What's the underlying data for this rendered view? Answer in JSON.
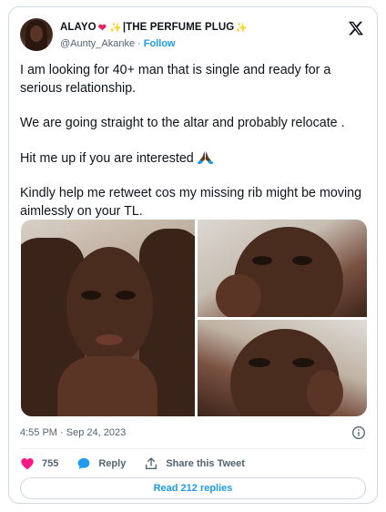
{
  "author": {
    "name": "ALAYO",
    "name_suffix": "|THE PERFUME PLUG",
    "handle": "@Aunty_Akanke",
    "separator": "·",
    "follow_label": "Follow"
  },
  "tweet": {
    "paragraphs": [
      "I am looking for 40+ man that is single and ready for a serious relationship.",
      "We are going straight to the altar and probably relocate .",
      "Hit me up if you are interested",
      "Kindly help me retweet cos my missing rib might be moving aimlessly on your TL."
    ],
    "timestamp": "4:55 PM · Sep 24, 2023"
  },
  "actions": {
    "like_count": "755",
    "reply_label": "Reply",
    "share_label": "Share this Tweet"
  },
  "replies_button": "Read 212 replies",
  "icons": {
    "logo": "x-logo-icon",
    "like": "heart-icon",
    "reply": "speech-bubble-icon",
    "share": "share-arrow-icon",
    "info": "info-icon"
  },
  "colors": {
    "accent": "#1d9bf0",
    "like": "#f91880",
    "text": "#0f1419",
    "muted": "#536471",
    "border": "#cfd9de"
  }
}
